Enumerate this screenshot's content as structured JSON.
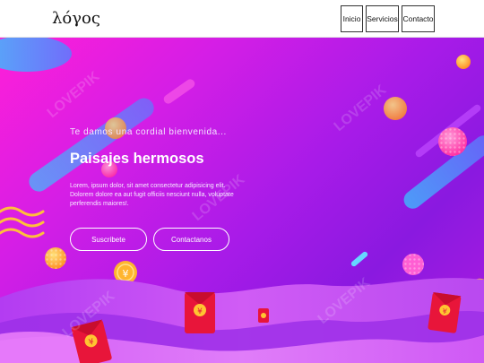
{
  "header": {
    "logo": "λόγος",
    "nav": [
      "Inicio",
      "Servicios",
      "Contacto"
    ]
  },
  "hero": {
    "subtitle": "Te damos una cordial bienvenida...",
    "title": "Paisajes hermosos",
    "description": "Lorem, ipsum dolor, sit amet consectetur adipisicing elit. Dolorem dolore ea aut fugit officiis nesciunt nulla, voluptate perferendis maiores!.",
    "subscribe_label": "Suscribete",
    "contact_label": "Contactanos"
  },
  "watermark": "LOVEPIK",
  "colors": {
    "accent_pink": "#ff1fd8",
    "accent_purple": "#8a19e0",
    "ground_violet": "#c43ef0",
    "envelope_red": "#e8153a",
    "coin_gold": "#ffb52e"
  }
}
